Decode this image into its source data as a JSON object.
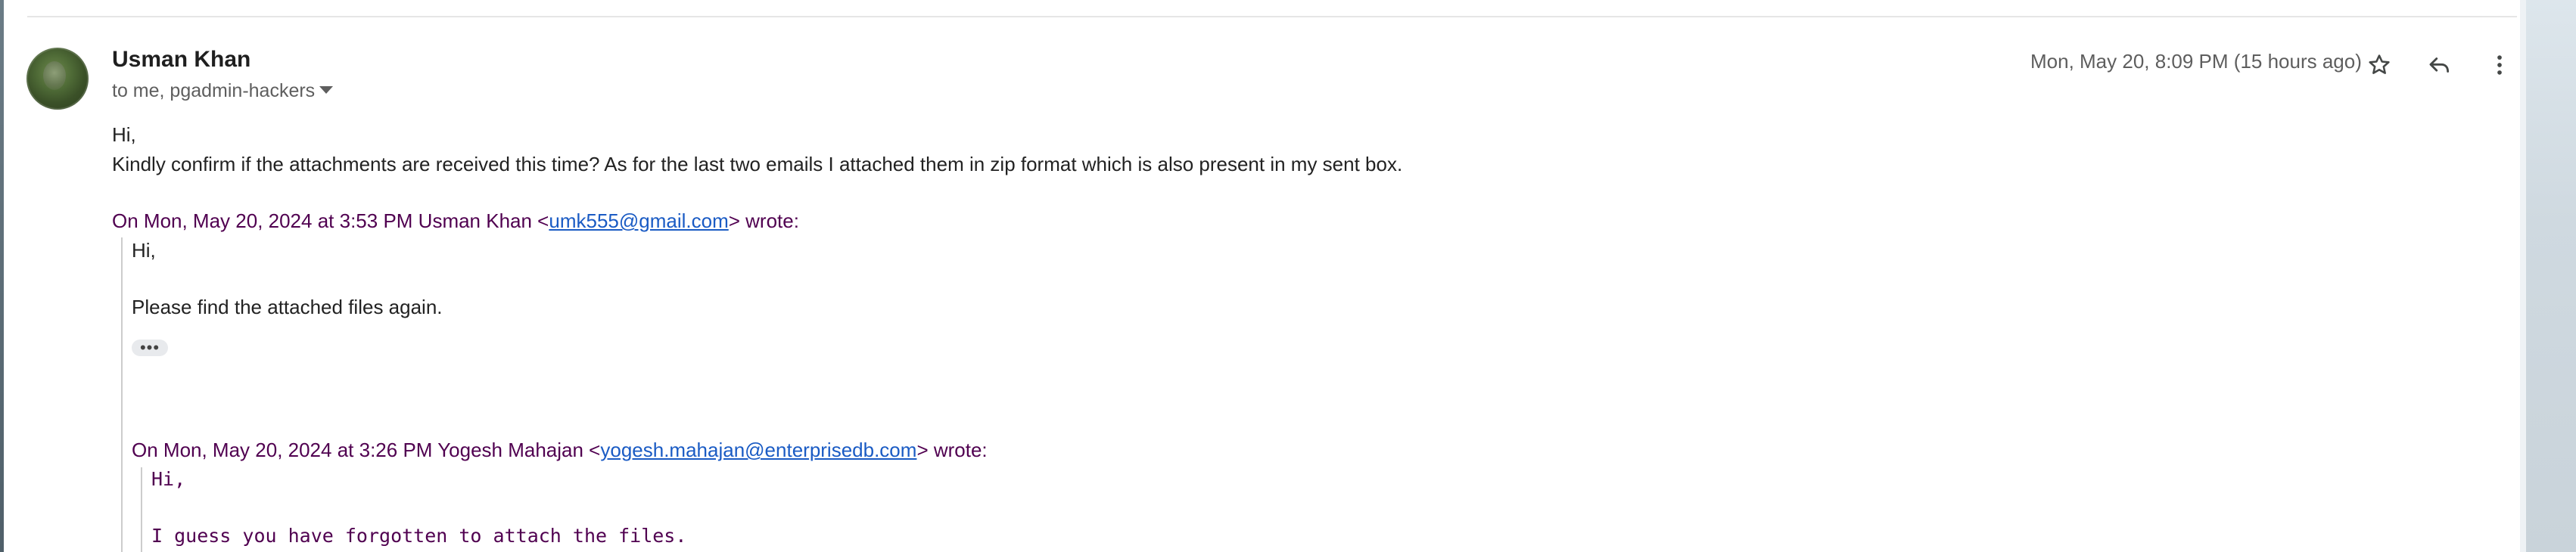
{
  "email": {
    "sender_name": "Usman Khan",
    "recipients": "to me, pgadmin-hackers",
    "timestamp": "Mon, May 20, 8:09 PM (15 hours ago)",
    "body": {
      "line1": "Hi,",
      "line2": "Kindly confirm if the attachments are received this time? As for the last two emails I attached them in zip format which is also present in my sent box."
    }
  },
  "quote1": {
    "header_prefix": "On Mon, May 20, 2024 at 3:53 PM Usman Khan <",
    "email": "umk555@gmail.com",
    "header_suffix": "> wrote:",
    "line1": "Hi,",
    "line2": "Please find the attached files again.",
    "ellipsis": "•••"
  },
  "quote2": {
    "header_prefix": "On Mon, May 20, 2024 at 3:26 PM Yogesh Mahajan <",
    "email": "yogesh.mahajan@enterprisedb.com",
    "header_suffix": "> wrote:",
    "line1": "Hi,",
    "line2": "I guess you have forgotten to attach the files."
  },
  "icons": {
    "star": "star-icon",
    "reply": "reply-icon",
    "more": "more-vert-icon",
    "caret": "chevron-down-icon"
  },
  "colors": {
    "quote_header": "#500050",
    "link": "#1a5bc4",
    "muted": "#5e5e5e"
  }
}
